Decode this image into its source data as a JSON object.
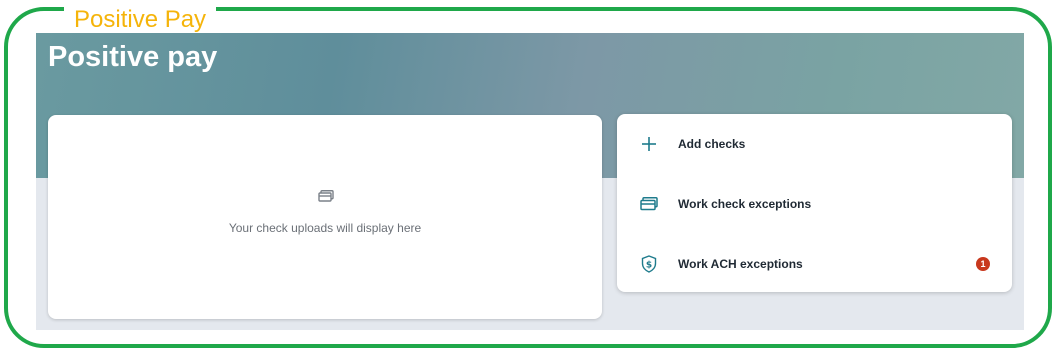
{
  "frame": {
    "title": "Positive Pay",
    "border_color": "#1fa84a",
    "title_color": "#f5b40a"
  },
  "page": {
    "title": "Positive pay"
  },
  "uploads": {
    "icon": "check-stack-icon",
    "empty_message": "Your check uploads will display here"
  },
  "actions": [
    {
      "label": "Add checks",
      "icon": "plus-icon"
    },
    {
      "label": "Work check exceptions",
      "icon": "check-card-icon"
    },
    {
      "label": "Work ACH exceptions",
      "icon": "shield-dollar-icon",
      "badge": "1"
    }
  ],
  "colors": {
    "accent": "#1e7b8c",
    "badge": "#c8381d",
    "hero": "#6a9aa0"
  }
}
